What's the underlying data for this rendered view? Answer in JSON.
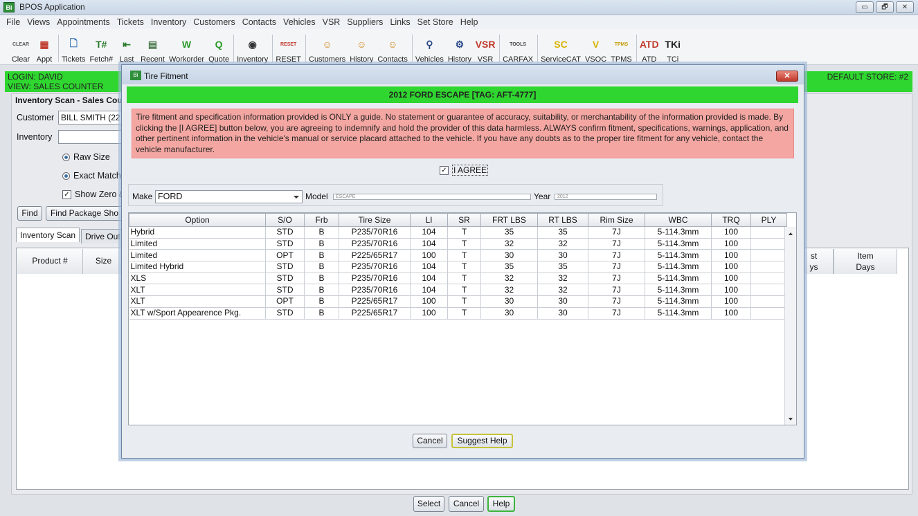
{
  "window": {
    "title": "BPOS Application",
    "app_icon_text": "Bi",
    "buttons": [
      "▭",
      "🗗",
      "✕"
    ]
  },
  "menu": [
    "File",
    "Views",
    "Appointments",
    "Tickets",
    "Inventory",
    "Customers",
    "Contacts",
    "Vehicles",
    "VSR",
    "Suppliers",
    "Links",
    "Set Store",
    "Help"
  ],
  "toolbar": [
    {
      "label": "Clear",
      "glyph": "CLEAR",
      "color": "#555"
    },
    {
      "label": "Appt",
      "glyph": "▦",
      "color": "#c0392b"
    },
    {
      "label": "Tickets",
      "glyph": "🗋",
      "color": "#2a6db0"
    },
    {
      "label": "Fetch#",
      "glyph": "T#",
      "color": "#2a7a2a"
    },
    {
      "label": "Last",
      "glyph": "⇤",
      "color": "#2a7a2a"
    },
    {
      "label": "Recent",
      "glyph": "▤",
      "color": "#4a7a4a"
    },
    {
      "label": "Workorder",
      "glyph": "W",
      "color": "#2a9a2a"
    },
    {
      "label": "Quote",
      "glyph": "Q",
      "color": "#2a9a2a"
    },
    {
      "label": "Inventory",
      "glyph": "◉",
      "color": "#333"
    },
    {
      "label": "RESET",
      "glyph": "RESET",
      "color": "#c0392b"
    },
    {
      "label": "Customers",
      "glyph": "☺",
      "color": "#d08a1a"
    },
    {
      "label": "History",
      "glyph": "☺",
      "color": "#d08a1a"
    },
    {
      "label": "Contacts",
      "glyph": "☺",
      "color": "#d08a1a"
    },
    {
      "label": "Vehicles",
      "glyph": "⚲",
      "color": "#2a4a8a"
    },
    {
      "label": "History",
      "glyph": "⚙",
      "color": "#2a4a8a"
    },
    {
      "label": "VSR",
      "glyph": "VSR",
      "color": "#c0392b"
    },
    {
      "label": "CARFAX",
      "glyph": "TOOLS",
      "color": "#444"
    },
    {
      "label": "ServiceCAT",
      "glyph": "SC",
      "color": "#d8b300"
    },
    {
      "label": "VSOC",
      "glyph": "V",
      "color": "#d8b300"
    },
    {
      "label": "TPMS",
      "glyph": "TPMS",
      "color": "#c49a00"
    },
    {
      "label": "ATD",
      "glyph": "ATD",
      "color": "#c0392b"
    },
    {
      "label": "TCi",
      "glyph": "TKi",
      "color": "#222"
    }
  ],
  "status": {
    "login": "LOGIN: DAVID",
    "view": "VIEW: SALES COUNTER",
    "store": "DEFAULT STORE: #2"
  },
  "left_panel": {
    "title": "Inventory Scan - Sales Cou",
    "customer_label": "Customer",
    "customer_value": "BILL SMITH (22",
    "inventory_label": "Inventory",
    "raw_size": "Raw Size",
    "exact_match": "Exact Match",
    "show_zero": "Show Zero &",
    "find": "Find",
    "find_package": "Find Package Sho",
    "tabs": [
      "Inventory Scan",
      "Drive Out"
    ],
    "headers": {
      "product": "Product #",
      "size": "Size",
      "cost_days_line1": "st",
      "cost_days_line2": "ys",
      "item_days_line1": "Item",
      "item_days_line2": "Days"
    }
  },
  "dialog": {
    "title": "Tire Fitment",
    "close": "✕",
    "vehicle": "2012 FORD ESCAPE [TAG: AFT-4777]",
    "disclaimer": "Tire fitment and specification information provided is ONLY a guide.  No statement or guarantee of accuracy, suitability, or merchantability of the information provided is made. By clicking the [I AGREE] button below, you are agreeing to indemnify and hold the provider of this data harmless. ALWAYS confirm fitment, specifications, warnings, application, and other pertinent information in the vehicle's manual or service placard attached to the vehicle. If you have any doubts as to the proper tire fitment for any vehicle, contact the vehicle manufacturer.",
    "agree_label": "I AGREE",
    "make_label": "Make",
    "make_value": "FORD",
    "model_label": "Model",
    "model_value": "ESCAPE",
    "year_label": "Year",
    "year_value": "2012",
    "columns": [
      "Option",
      "S/O",
      "Frb",
      "Tire Size",
      "LI",
      "SR",
      "FRT LBS",
      "RT LBS",
      "Rim Size",
      "WBC",
      "TRQ",
      "PLY"
    ],
    "rows": [
      [
        "Hybrid",
        "STD",
        "B",
        "P235/70R16",
        "104",
        "T",
        "35",
        "35",
        "7J",
        "5-114.3mm",
        "100",
        ""
      ],
      [
        "Limited",
        "STD",
        "B",
        "P235/70R16",
        "104",
        "T",
        "32",
        "32",
        "7J",
        "5-114.3mm",
        "100",
        ""
      ],
      [
        "Limited",
        "OPT",
        "B",
        "P225/65R17",
        "100",
        "T",
        "30",
        "30",
        "7J",
        "5-114.3mm",
        "100",
        ""
      ],
      [
        "Limited Hybrid",
        "STD",
        "B",
        "P235/70R16",
        "104",
        "T",
        "35",
        "35",
        "7J",
        "5-114.3mm",
        "100",
        ""
      ],
      [
        "XLS",
        "STD",
        "B",
        "P235/70R16",
        "104",
        "T",
        "32",
        "32",
        "7J",
        "5-114.3mm",
        "100",
        ""
      ],
      [
        "XLT",
        "STD",
        "B",
        "P235/70R16",
        "104",
        "T",
        "32",
        "32",
        "7J",
        "5-114.3mm",
        "100",
        ""
      ],
      [
        "XLT",
        "OPT",
        "B",
        "P225/65R17",
        "100",
        "T",
        "30",
        "30",
        "7J",
        "5-114.3mm",
        "100",
        ""
      ],
      [
        "XLT w/Sport Appearence Pkg.",
        "STD",
        "B",
        "P225/65R17",
        "100",
        "T",
        "30",
        "30",
        "7J",
        "5-114.3mm",
        "100",
        ""
      ]
    ],
    "cancel": "Cancel",
    "suggest_help": "Suggest Help"
  },
  "footer": {
    "select": "Select",
    "cancel": "Cancel",
    "help": "Help"
  }
}
